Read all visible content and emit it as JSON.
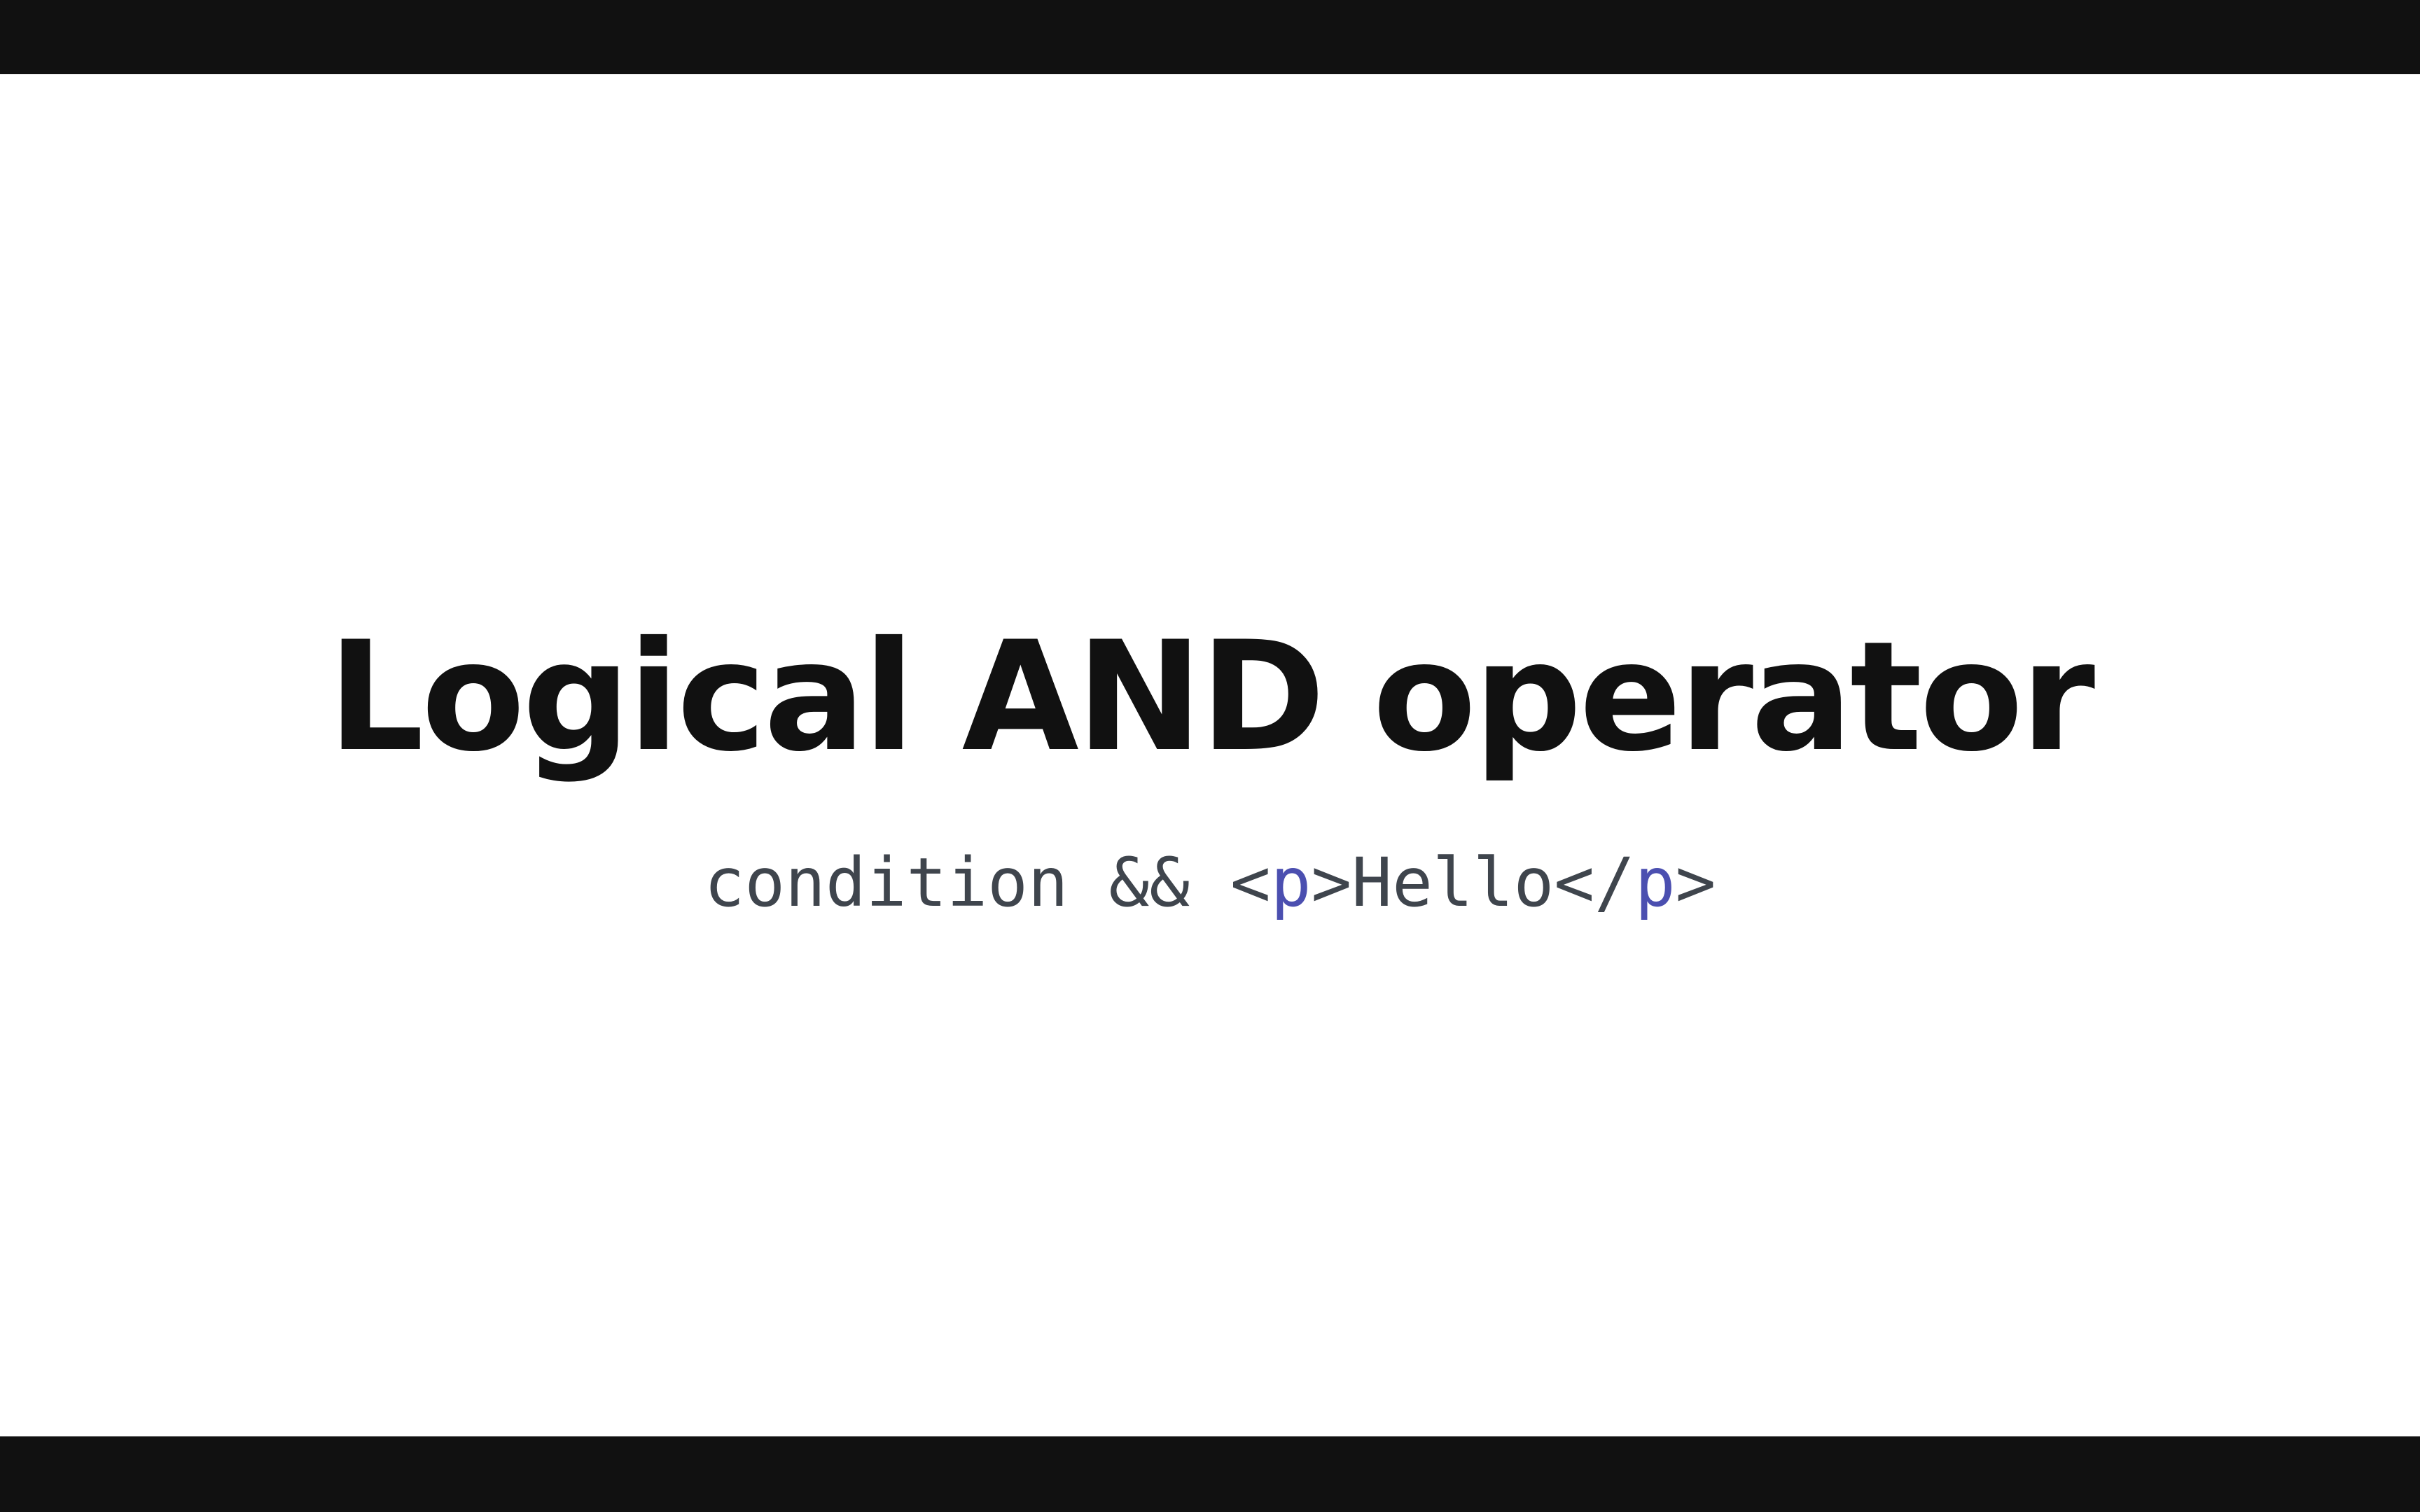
{
  "slide": {
    "title": "Logical AND operator",
    "code": {
      "condition": "condition",
      "operator": "&&",
      "open_bracket": "<",
      "open_tag": "p",
      "close_bracket_1": ">",
      "text": "Hello",
      "close_open": "</",
      "close_tag": "p",
      "close_bracket_2": ">"
    }
  },
  "colors": {
    "background": "#ffffff",
    "bars": "#111111",
    "title": "#111111",
    "code_text": "#3f454d",
    "code_tag": "#4b4fb0"
  }
}
